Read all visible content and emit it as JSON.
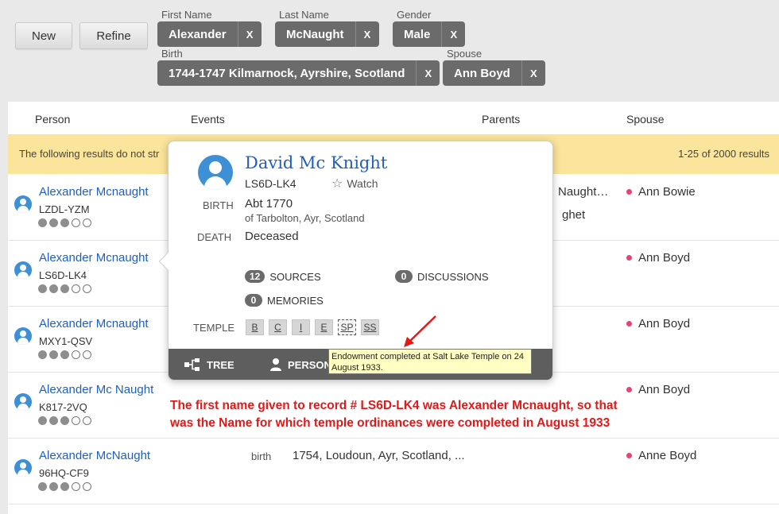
{
  "toolbar": {
    "new_label": "New",
    "refine_label": "Refine"
  },
  "filters": {
    "first_name": {
      "label": "First Name",
      "value": "Alexander",
      "remove": "X"
    },
    "last_name": {
      "label": "Last Name",
      "value": "McNaught",
      "remove": "X"
    },
    "gender": {
      "label": "Gender",
      "value": "Male",
      "remove": "X"
    },
    "birth": {
      "label": "Birth",
      "value": "1744-1747 Kilmarnock, Ayrshire, Scotland",
      "remove": "X"
    },
    "spouse": {
      "label": "Spouse",
      "value": "Ann Boyd",
      "remove": "X"
    }
  },
  "columns": {
    "person": "Person",
    "events": "Events",
    "parents": "Parents",
    "spouse": "Spouse"
  },
  "notice": {
    "text": "The following results do not str",
    "count": "1-25 of 2000 results"
  },
  "results": [
    {
      "name": "Alexander Mcnaught",
      "id": "LZDL-YZM",
      "stars": 3,
      "spouse": "Ann Bowie",
      "parents_line1": "Naught…",
      "parents_line2": "ghet"
    },
    {
      "name": "Alexander Mcnaught",
      "id": "LS6D-LK4",
      "stars": 3,
      "spouse": "Ann Boyd"
    },
    {
      "name": "Alexander Mcnaught",
      "id": "MXY1-QSV",
      "stars": 3,
      "spouse": "Ann Boyd"
    },
    {
      "name": "Alexander Mc Naught",
      "id": "K817-2VQ",
      "stars": 3,
      "spouse": "Ann Boyd"
    },
    {
      "name": "Alexander McNaught",
      "id": "96HQ-CF9",
      "stars": 3,
      "spouse": "Anne Boyd",
      "event_label": "birth",
      "event_value": "1754, Loudoun, Ayr, Scotland, ..."
    }
  ],
  "popup": {
    "name": "David Mc Knight",
    "id": "LS6D-LK4",
    "watch": "Watch",
    "birth_label": "BIRTH",
    "birth_date": "Abt 1770",
    "birth_place": "of Tarbolton, Ayr, Scotland",
    "death_label": "DEATH",
    "death_value": "Deceased",
    "sources_count": "12",
    "sources_label": "SOURCES",
    "discussions_count": "0",
    "discussions_label": "DISCUSSIONS",
    "memories_count": "0",
    "memories_label": "MEMORIES",
    "temple_label": "TEMPLE",
    "temple_ordinances": [
      "B",
      "C",
      "I",
      "E",
      "SP",
      "SS"
    ],
    "tree_label": "TREE",
    "person_label": "PERSON",
    "tooltip": "Endowment completed at Salt Lake Temple on 24 August 1933."
  },
  "annotation": {
    "line1": "The first name given to record # LS6D-LK4 was Alexander Mcnaught, so that",
    "line2": "was the Name for which temple ordinances were completed in August 1933",
    "color": "#e41818"
  },
  "colors": {
    "link": "#1f5fbf",
    "notice_bg": "#fbe49b",
    "chip_bg": "#6b6b6b",
    "spouse_dot": "#e0457b",
    "avatar": "#3d8fd6"
  }
}
